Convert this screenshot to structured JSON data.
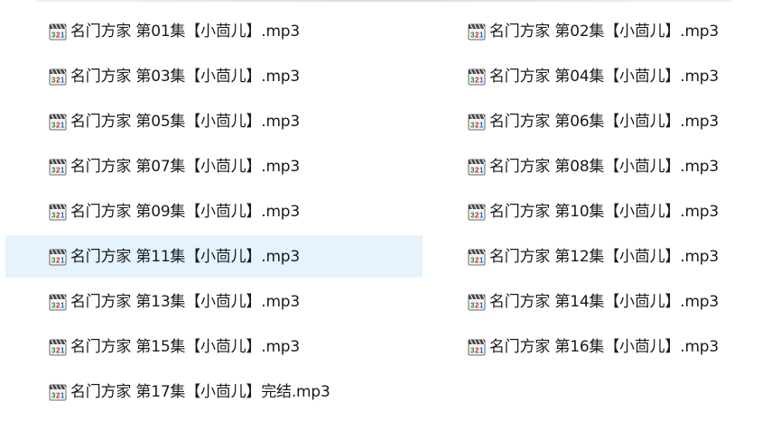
{
  "icon": "media-player-classic-audio-icon",
  "colors": {
    "selection": "#e5f3ff",
    "text": "#1a1a1a"
  },
  "files": [
    "名门方家 第01集【小茴儿】.mp3",
    "名门方家 第02集【小茴儿】.mp3",
    "名门方家 第03集【小茴儿】.mp3",
    "名门方家 第04集【小茴儿】.mp3",
    "名门方家 第05集【小茴儿】.mp3",
    "名门方家 第06集【小茴儿】.mp3",
    "名门方家 第07集【小茴儿】.mp3",
    "名门方家 第08集【小茴儿】.mp3",
    "名门方家 第09集【小茴儿】.mp3",
    "名门方家 第10集【小茴儿】.mp3",
    "名门方家 第11集【小茴儿】.mp3",
    "名门方家 第12集【小茴儿】.mp3",
    "名门方家 第13集【小茴儿】.mp3",
    "名门方家 第14集【小茴儿】.mp3",
    "名门方家 第15集【小茴儿】.mp3",
    "名门方家 第16集【小茴儿】.mp3",
    "名门方家 第17集【小茴儿】完结.mp3"
  ],
  "hovered_index": 10
}
